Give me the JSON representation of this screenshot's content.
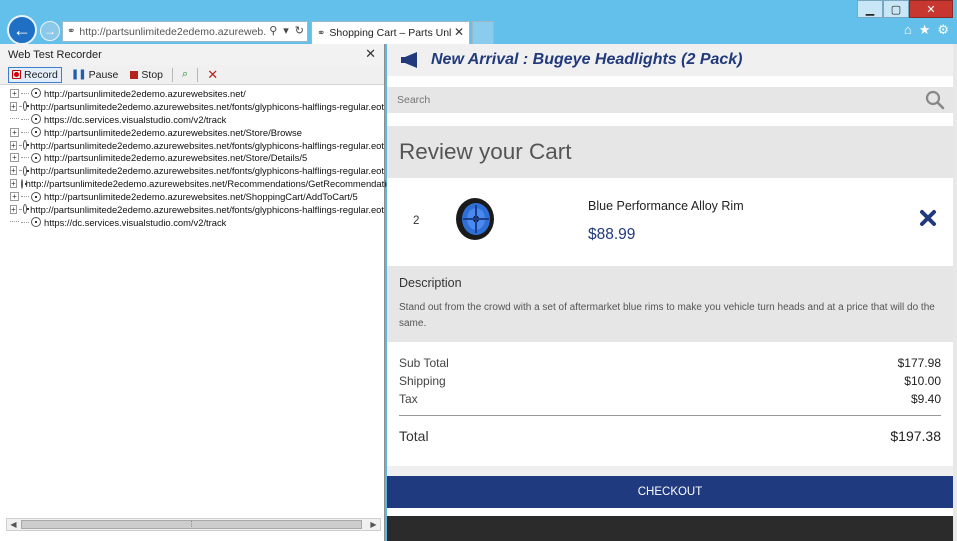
{
  "browser": {
    "address_url": "http://partsunlimitede2edemo.azureweb...",
    "tab_title": "Shopping Cart – Parts Unli...",
    "window_controls": {
      "minimize": "▁",
      "maximize": "▢",
      "close": "✕"
    },
    "toolbar_icons": [
      "home-icon",
      "star-icon",
      "gear-icon"
    ]
  },
  "recorder": {
    "title": "Web Test Recorder",
    "buttons": {
      "record": "Record",
      "pause": "Pause",
      "stop": "Stop"
    },
    "requests": [
      {
        "url": "http://partsunlimitede2edemo.azurewebsites.net/",
        "expandable": true
      },
      {
        "url": "http://partsunlimitede2edemo.azurewebsites.net/fonts/glyphicons-halflings-regular.eot",
        "expandable": true
      },
      {
        "url": "https://dc.services.visualstudio.com/v2/track",
        "expandable": false
      },
      {
        "url": "http://partsunlimitede2edemo.azurewebsites.net/Store/Browse",
        "expandable": true
      },
      {
        "url": "http://partsunlimitede2edemo.azurewebsites.net/fonts/glyphicons-halflings-regular.eot",
        "expandable": true
      },
      {
        "url": "http://partsunlimitede2edemo.azurewebsites.net/Store/Details/5",
        "expandable": true
      },
      {
        "url": "http://partsunlimitede2edemo.azurewebsites.net/fonts/glyphicons-halflings-regular.eot",
        "expandable": true
      },
      {
        "url": "http://partsunlimitede2edemo.azurewebsites.net/Recommendations/GetRecommendation:",
        "expandable": true
      },
      {
        "url": "http://partsunlimitede2edemo.azurewebsites.net/ShoppingCart/AddToCart/5",
        "expandable": true
      },
      {
        "url": "http://partsunlimitede2edemo.azurewebsites.net/fonts/glyphicons-halflings-regular.eot",
        "expandable": true
      },
      {
        "url": "https://dc.services.visualstudio.com/v2/track",
        "expandable": false
      }
    ]
  },
  "page": {
    "banner": "New Arrival : Bugeye Headlights (2 Pack)",
    "search_placeholder": "Search",
    "heading": "Review your Cart",
    "item": {
      "quantity": "2",
      "name": "Blue Performance Alloy Rim",
      "price": "$88.99"
    },
    "description": {
      "title": "Description",
      "body": "Stand out from the crowd with a set of aftermarket blue rims to make you vehicle turn heads and at a price that will do the same."
    },
    "totals": {
      "subtotal_label": "Sub Total",
      "subtotal": "$177.98",
      "shipping_label": "Shipping",
      "shipping": "$10.00",
      "tax_label": "Tax",
      "tax": "$9.40",
      "total_label": "Total",
      "total": "$197.38"
    },
    "checkout_label": "CHECKOUT"
  },
  "colors": {
    "browser_chrome": "#62c0ea",
    "brand_navy": "#213a7b",
    "checkout_bg": "#1f3a7e",
    "panel_grey": "#e6e6e6"
  }
}
